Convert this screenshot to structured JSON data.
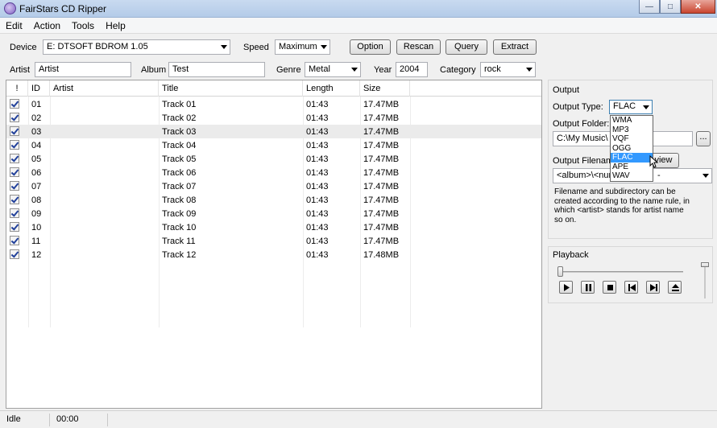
{
  "window": {
    "title": "FairStars CD Ripper"
  },
  "menu": [
    "Edit",
    "Action",
    "Tools",
    "Help"
  ],
  "device_bar": {
    "device_label": "Device",
    "device_value": "E: DTSOFT BDROM 1.05",
    "speed_label": "Speed",
    "speed_value": "Maximum",
    "buttons": [
      "Option",
      "Rescan",
      "Query",
      "Extract"
    ]
  },
  "meta_bar": {
    "artist_label": "Artist",
    "artist_value": "Artist",
    "album_label": "Album",
    "album_value": "Test",
    "genre_label": "Genre",
    "genre_value": "Metal",
    "year_label": "Year",
    "year_value": "2004",
    "category_label": "Category",
    "category_value": "rock"
  },
  "table": {
    "headers": [
      "!",
      "ID",
      "Artist",
      "Title",
      "Length",
      "Size"
    ],
    "rows": [
      {
        "id": "01",
        "artist": "",
        "title": "Track 01",
        "length": "01:43",
        "size": "17.47MB"
      },
      {
        "id": "02",
        "artist": "",
        "title": "Track 02",
        "length": "01:43",
        "size": "17.47MB"
      },
      {
        "id": "03",
        "artist": "",
        "title": "Track 03",
        "length": "01:43",
        "size": "17.47MB"
      },
      {
        "id": "04",
        "artist": "",
        "title": "Track 04",
        "length": "01:43",
        "size": "17.47MB"
      },
      {
        "id": "05",
        "artist": "",
        "title": "Track 05",
        "length": "01:43",
        "size": "17.47MB"
      },
      {
        "id": "06",
        "artist": "",
        "title": "Track 06",
        "length": "01:43",
        "size": "17.47MB"
      },
      {
        "id": "07",
        "artist": "",
        "title": "Track 07",
        "length": "01:43",
        "size": "17.47MB"
      },
      {
        "id": "08",
        "artist": "",
        "title": "Track 08",
        "length": "01:43",
        "size": "17.47MB"
      },
      {
        "id": "09",
        "artist": "",
        "title": "Track 09",
        "length": "01:43",
        "size": "17.47MB"
      },
      {
        "id": "10",
        "artist": "",
        "title": "Track 10",
        "length": "01:43",
        "size": "17.47MB"
      },
      {
        "id": "11",
        "artist": "",
        "title": "Track 11",
        "length": "01:43",
        "size": "17.47MB"
      },
      {
        "id": "12",
        "artist": "",
        "title": "Track 12",
        "length": "01:43",
        "size": "17.48MB"
      }
    ]
  },
  "output": {
    "section_label": "Output",
    "type_label": "Output Type:",
    "type_value": "FLAC",
    "type_options": [
      "WMA",
      "MP3",
      "VQF",
      "OGG",
      "FLAC",
      "APE",
      "WAV"
    ],
    "folder_label": "Output Folder:",
    "folder_value": "C:\\My Music\\",
    "browse_label": "...",
    "filename_label": "Output Filename",
    "preview_label": "view",
    "filename_value": "<album>\\<num",
    "filename_tail": "-",
    "help_text": "Filename and subdirectory can be created according to the name rule, in which <artist> stands for artist name so on."
  },
  "playback": {
    "section_label": "Playback"
  },
  "status": {
    "state": "Idle",
    "time": "00:00"
  },
  "colors": {
    "selection": "#3399ff",
    "check": "#21409a"
  }
}
